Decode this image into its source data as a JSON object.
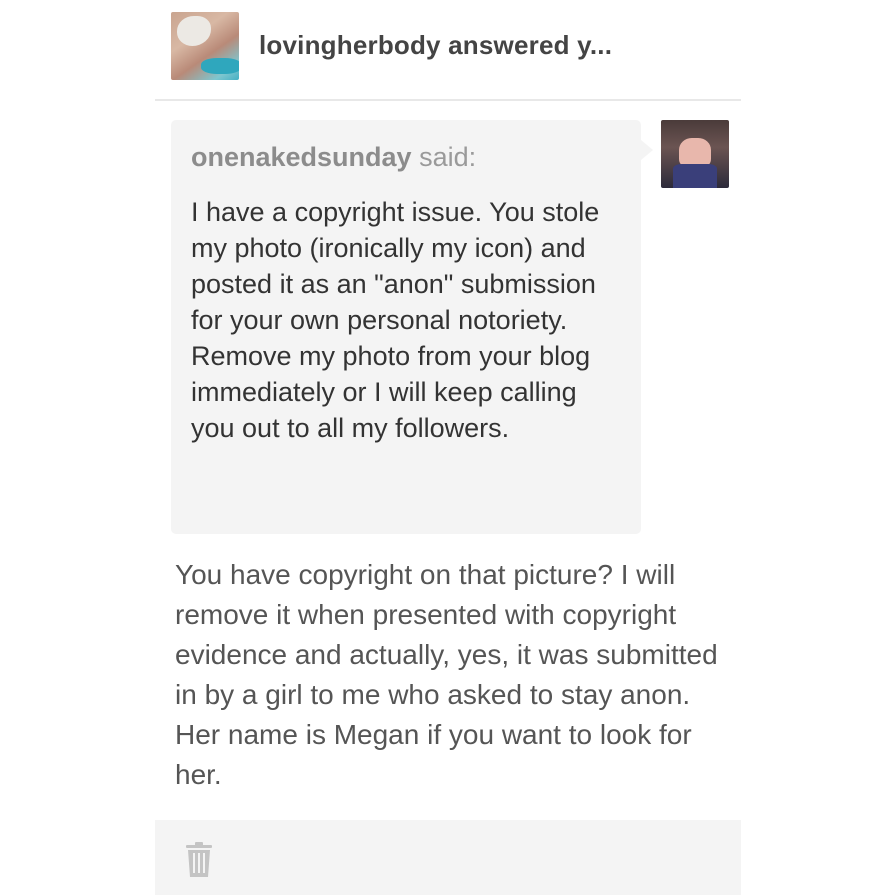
{
  "header": {
    "title": "lovingherbody answered y..."
  },
  "question": {
    "asker": "onenakedsunday",
    "said_label": "said:",
    "text": "I have a copyright issue. You stole my photo (ironically my icon) and posted it as an \"anon\" submission for your own personal notoriety. Remove my photo from your blog immediately or I will keep calling you out to all my followers."
  },
  "answer": {
    "text": "You have copyright on that picture? I will remove it when presented with copyright evidence and actually, yes, it was submitted in by a girl to me who asked to stay anon. Her name is Megan if you want to look for her."
  },
  "footer": {
    "delete_icon": "trash-icon"
  },
  "colors": {
    "quote_bg": "#f4f4f4",
    "title_text": "#444444",
    "byline_text": "#9a9a9a"
  }
}
